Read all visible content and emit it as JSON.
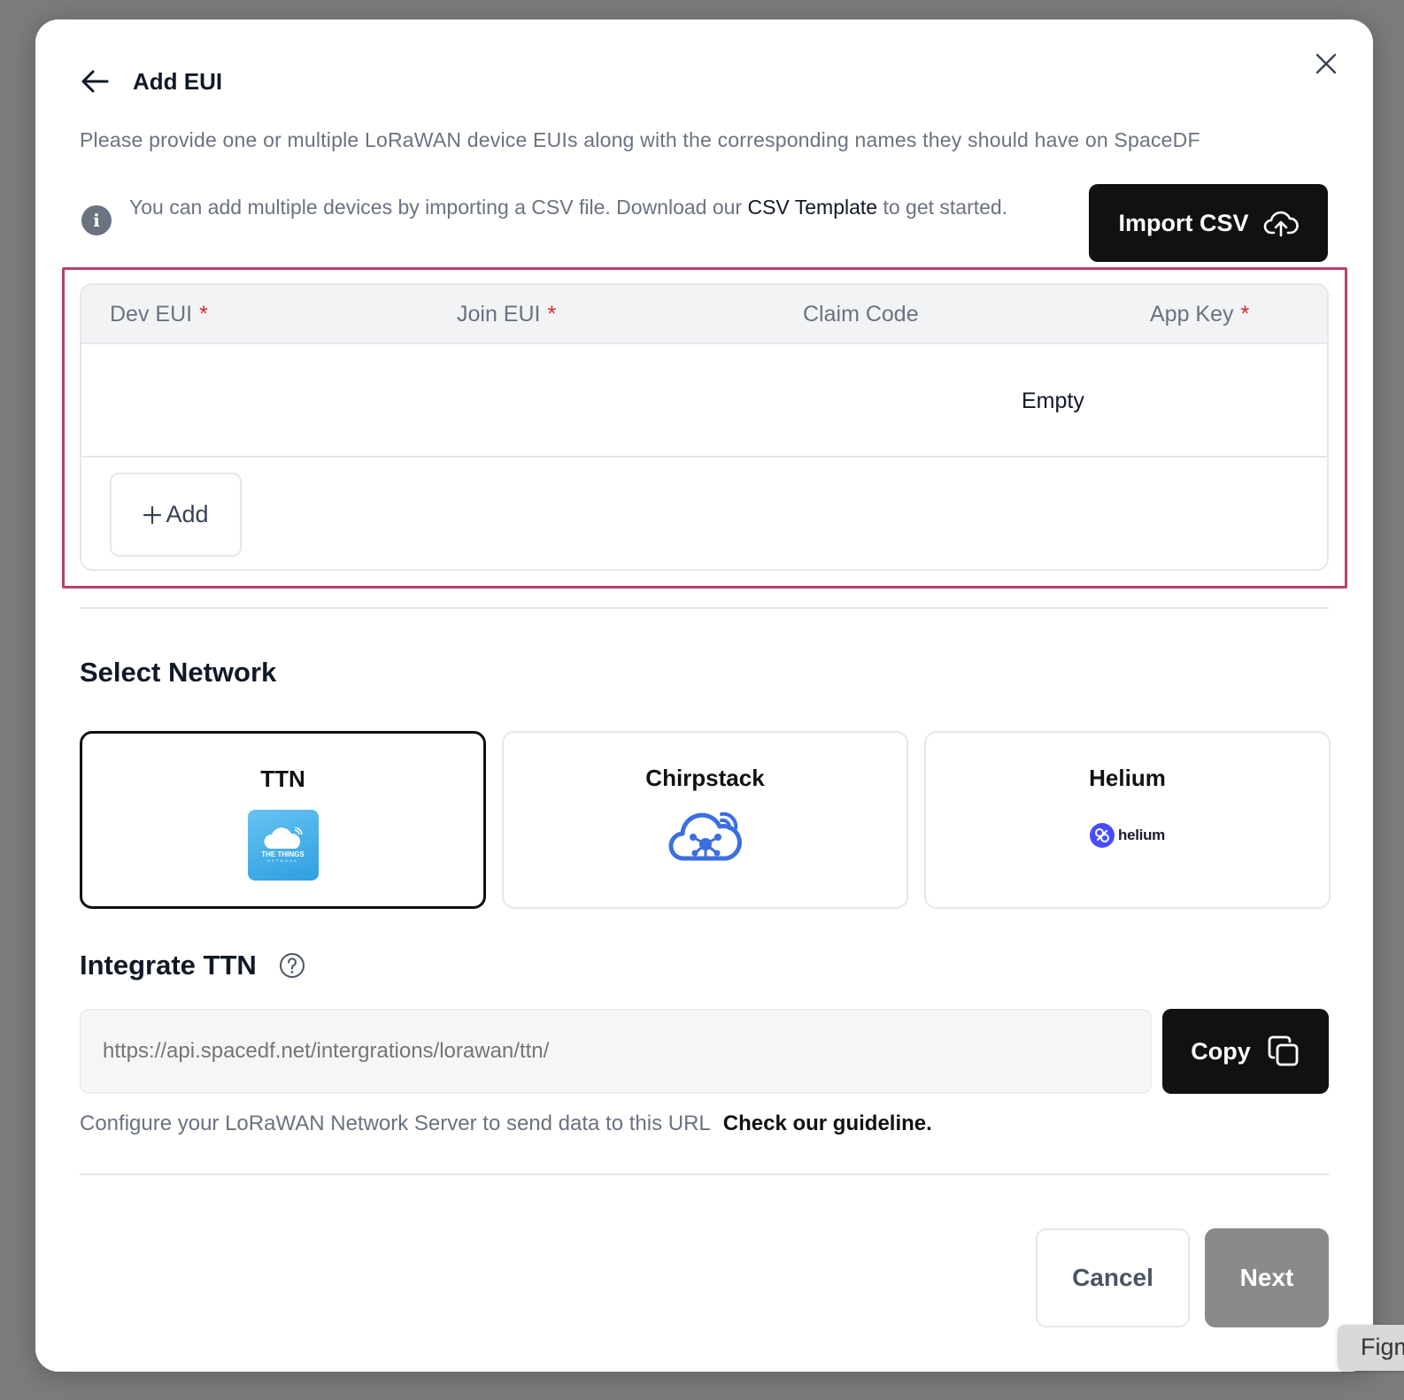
{
  "dialog": {
    "title": "Add EUI",
    "subtitle": "Please provide one or multiple LoRaWAN device EUIs along with the corresponding names they should have on SpaceDF"
  },
  "info": {
    "text_before": "You can add multiple devices by importing a CSV file. Download our ",
    "link": "CSV Template",
    "text_after": " to get started.",
    "import_button": "Import CSV"
  },
  "table": {
    "columns": [
      {
        "label": "Dev EUI",
        "required": "*"
      },
      {
        "label": "Join EUI",
        "required": "*"
      },
      {
        "label": "Claim Code",
        "required": ""
      },
      {
        "label": "App Key",
        "required": "*"
      }
    ],
    "empty_text": "Empty",
    "add_button": "Add"
  },
  "network": {
    "section_title": "Select Network",
    "options": [
      {
        "name": "TTN",
        "logo_text": "THE THINGS",
        "logo_subtext": "NETWORK",
        "selected": true
      },
      {
        "name": "Chirpstack",
        "selected": false
      },
      {
        "name": "Helium",
        "logo_text": "helium",
        "selected": false
      }
    ]
  },
  "integrate": {
    "title": "Integrate TTN",
    "url_placeholder": "https://api.spacedf.net/intergrations/lorawan/ttn/",
    "copy_button": "Copy",
    "config_text": "Configure your LoRaWAN Network Server to send data to this URL",
    "guideline_link": "Check our guideline."
  },
  "footer": {
    "cancel_button": "Cancel",
    "next_button": "Next"
  },
  "overlay": {
    "figma_tab": "Figma"
  },
  "colors": {
    "highlight": "#b5436c",
    "primary_button": "#111111",
    "disabled_button": "#8a8a8a",
    "required_marker": "#dc2626"
  }
}
